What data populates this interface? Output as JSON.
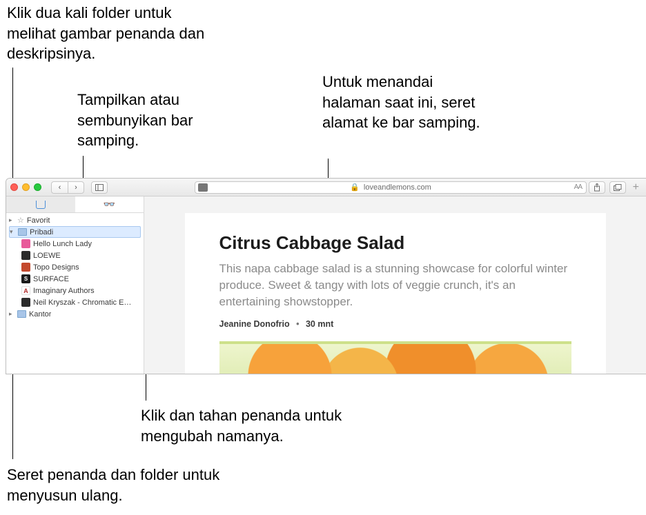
{
  "callouts": {
    "doubleClick": "Klik dua kali folder untuk melihat gambar penanda dan deskripsinya.",
    "showHide": "Tampilkan atau sembunyikan bar samping.",
    "dragAddress": "Untuk menandai halaman saat ini, seret alamat ke bar samping.",
    "clickHold": "Klik dan tahan penanda untuk mengubah namanya.",
    "reorder": "Seret penanda dan folder untuk menyusun ulang."
  },
  "toolbar": {
    "url": "loveandlemons.com",
    "readerAA": "AA"
  },
  "sidebar": {
    "favorit": "Favorit",
    "pribadi": "Pribadi",
    "items": [
      "Hello Lunch Lady",
      "LOEWE",
      "Topo Designs",
      "SURFACE",
      "Imaginary Authors",
      "Neil Kryszak - Chromatic E…"
    ],
    "kantor": "Kantor"
  },
  "article": {
    "title": "Citrus Cabbage Salad",
    "desc": "This napa cabbage salad is a stunning showcase for colorful winter produce. Sweet & tangy with lots of veggie crunch, it's an entertaining showstopper.",
    "author": "Jeanine Donofrio",
    "time": "30 mnt"
  }
}
